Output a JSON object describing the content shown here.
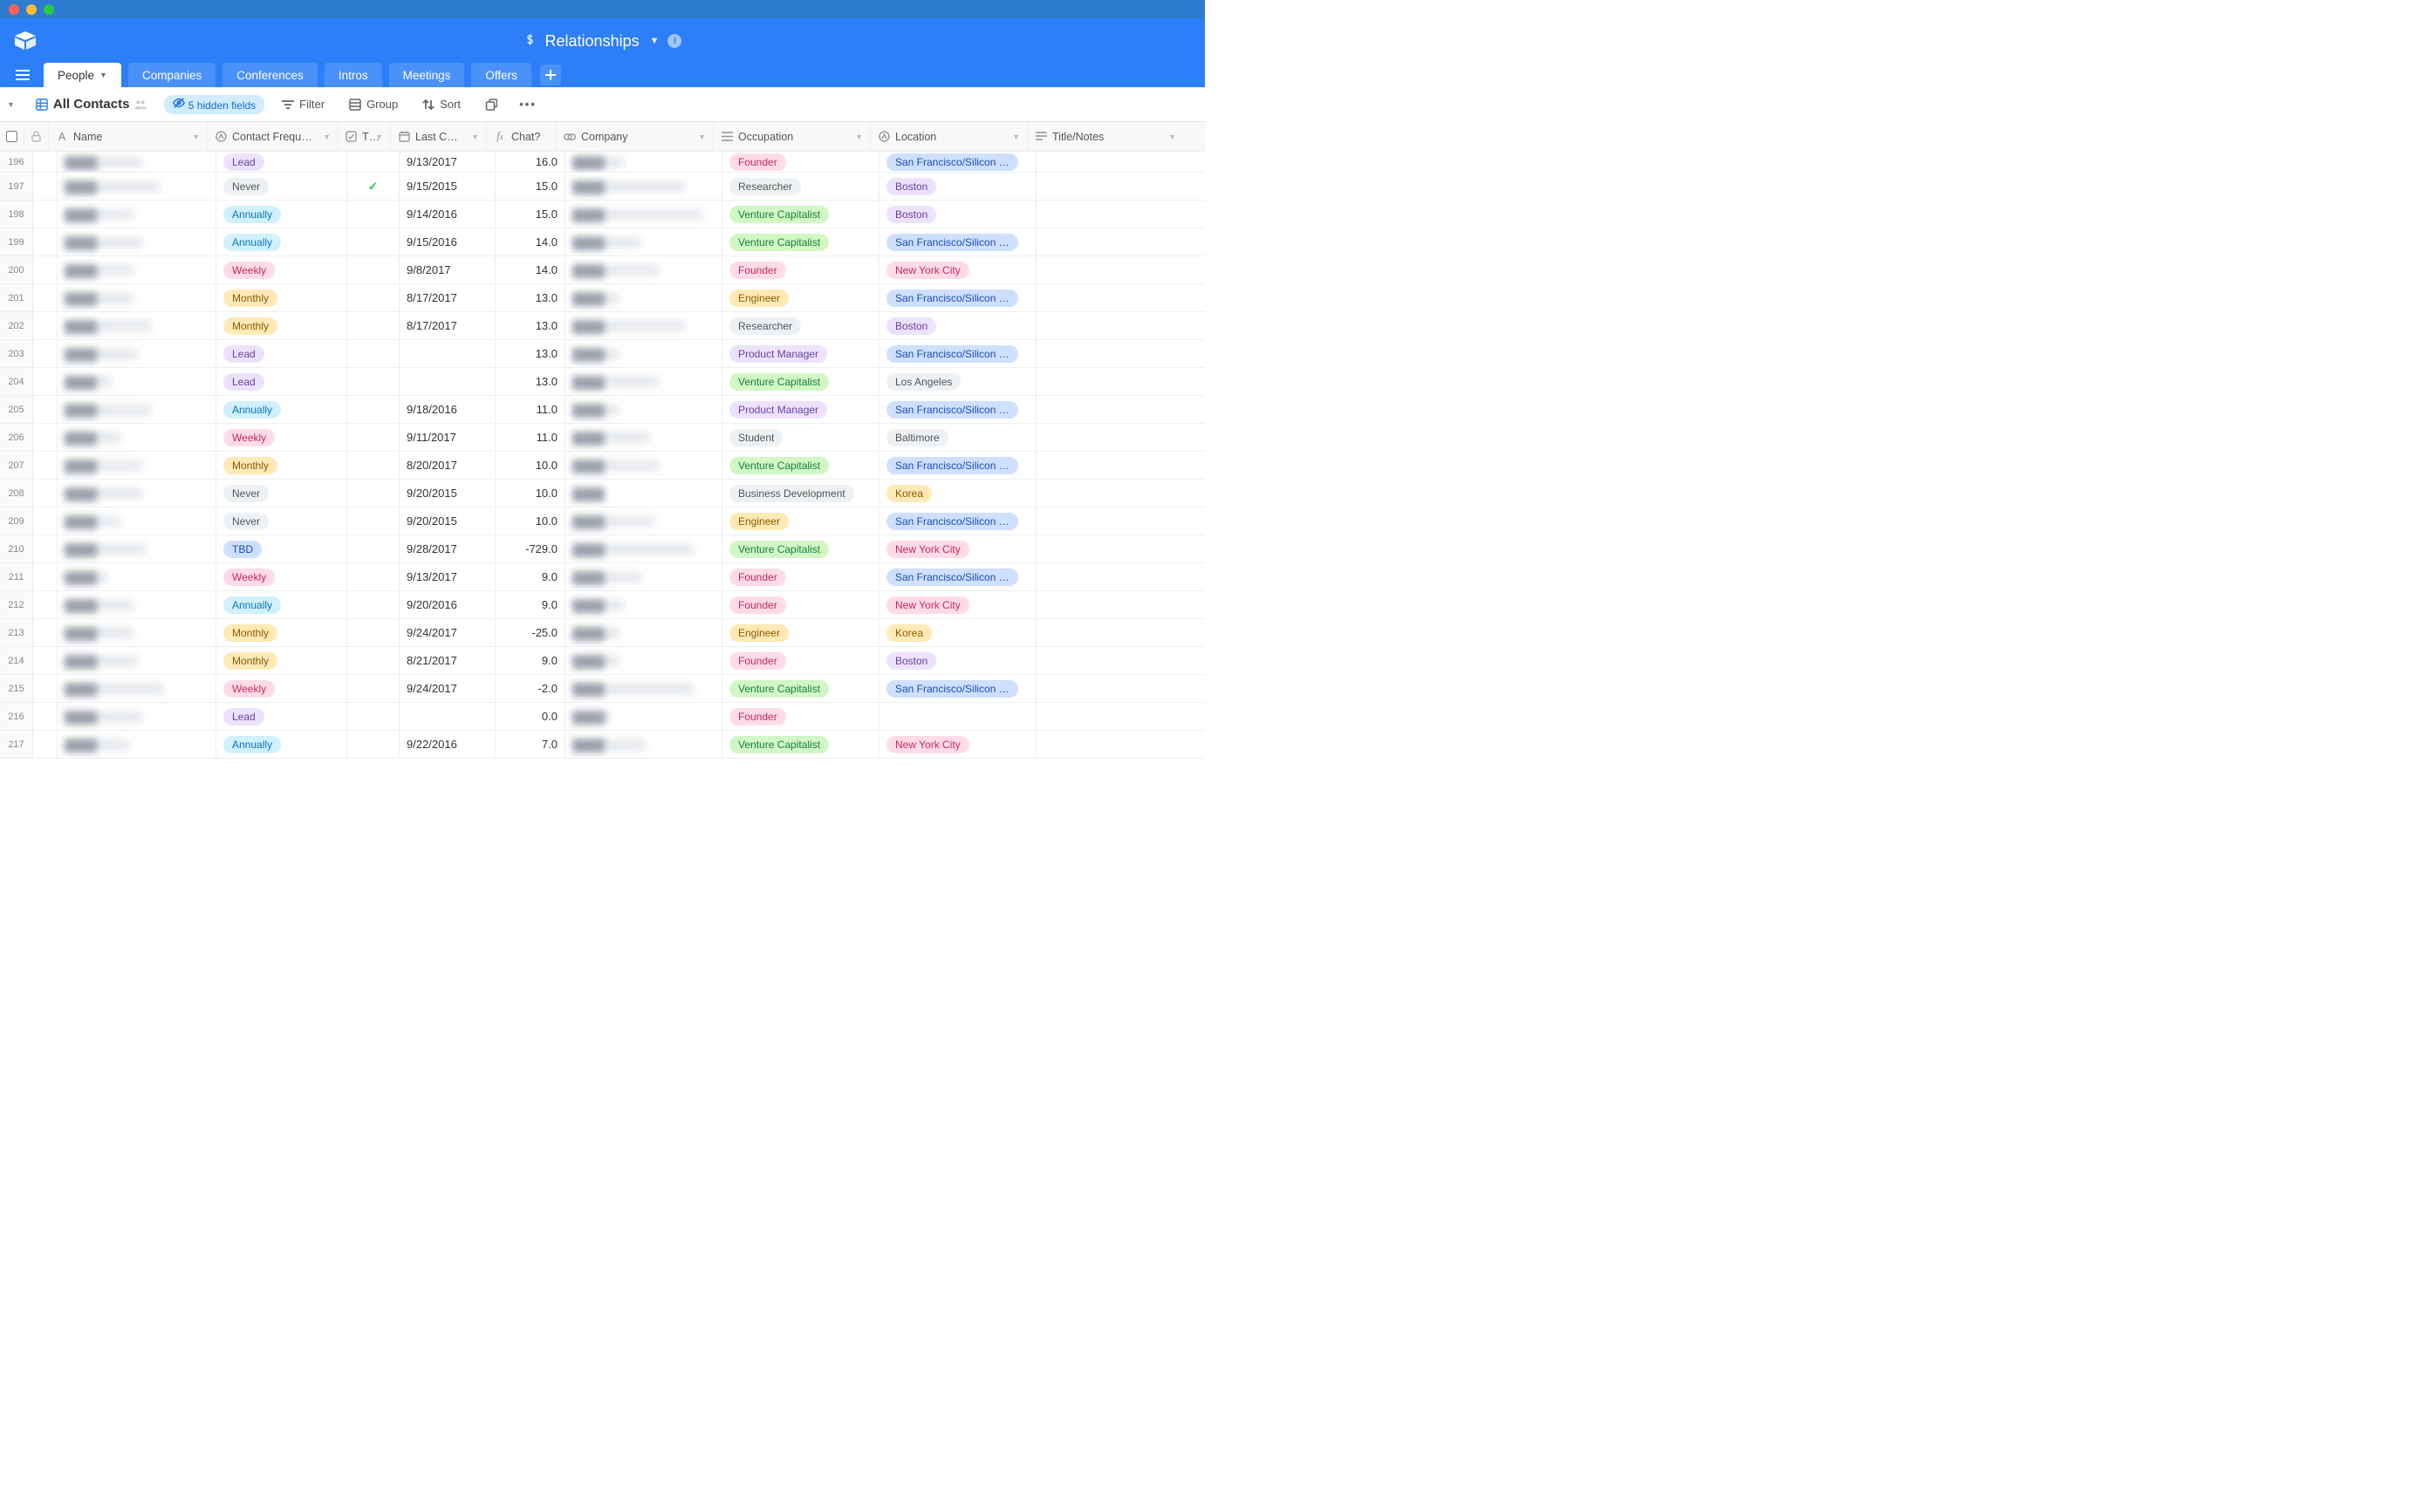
{
  "app": {
    "base_title": "Relationships"
  },
  "tabs": {
    "items": [
      {
        "label": "People",
        "active": true,
        "has_dropdown": true
      },
      {
        "label": "Companies"
      },
      {
        "label": "Conferences"
      },
      {
        "label": "Intros"
      },
      {
        "label": "Meetings"
      },
      {
        "label": "Offers"
      }
    ]
  },
  "toolbar": {
    "view_name": "All Contacts",
    "hidden_fields_label": "5 hidden fields",
    "filter_label": "Filter",
    "group_label": "Group",
    "sort_label": "Sort"
  },
  "columns": {
    "name": "Name",
    "contact_freq": "Contact Frequ…",
    "t": "T…",
    "last_c": "Last C…",
    "chat": "Chat?",
    "company": "Company",
    "occupation": "Occupation",
    "location": "Location",
    "title_notes": "Title/Notes"
  },
  "pill_colors": {
    "freq": {
      "Lead": "p-lead",
      "Never": "p-never",
      "Annually": "p-annually",
      "Weekly": "p-weekly",
      "Monthly": "p-monthly",
      "TBD": "p-tbd"
    },
    "occ": {
      "Founder": "o-founder",
      "Researcher": "o-researcher",
      "Venture Capitalist": "o-vc",
      "Engineer": "o-engineer",
      "Product Manager": "o-pm",
      "Student": "o-student",
      "Business Development": "o-bizdev"
    },
    "loc": {
      "San Francisco/Silicon …": "l-sf",
      "Boston": "l-boston",
      "New York City": "l-nyc",
      "Los Angeles": "l-la",
      "Baltimore": "l-balt",
      "Korea": "l-korea"
    }
  },
  "rows": [
    {
      "n": 196,
      "freq": "Lead",
      "t": false,
      "last": "9/13/2017",
      "chat": "16.0",
      "occ": "Founder",
      "loc": "San Francisco/Silicon …",
      "name_w": 90,
      "comp_w": 60
    },
    {
      "n": 197,
      "freq": "Never",
      "t": true,
      "last": "9/15/2015",
      "chat": "15.0",
      "occ": "Researcher",
      "loc": "Boston",
      "name_w": 110,
      "comp_w": 130
    },
    {
      "n": 198,
      "freq": "Annually",
      "t": false,
      "last": "9/14/2016",
      "chat": "15.0",
      "occ": "Venture Capitalist",
      "loc": "Boston",
      "name_w": 80,
      "comp_w": 150
    },
    {
      "n": 199,
      "freq": "Annually",
      "t": false,
      "last": "9/15/2016",
      "chat": "14.0",
      "occ": "Venture Capitalist",
      "loc": "San Francisco/Silicon …",
      "name_w": 90,
      "comp_w": 80
    },
    {
      "n": 200,
      "freq": "Weekly",
      "t": false,
      "last": "9/8/2017",
      "chat": "14.0",
      "occ": "Founder",
      "loc": "New York City",
      "name_w": 80,
      "comp_w": 100
    },
    {
      "n": 201,
      "freq": "Monthly",
      "t": false,
      "last": "8/17/2017",
      "chat": "13.0",
      "occ": "Engineer",
      "loc": "San Francisco/Silicon …",
      "name_w": 80,
      "comp_w": 55
    },
    {
      "n": 202,
      "freq": "Monthly",
      "t": false,
      "last": "8/17/2017",
      "chat": "13.0",
      "occ": "Researcher",
      "loc": "Boston",
      "name_w": 100,
      "comp_w": 130
    },
    {
      "n": 203,
      "freq": "Lead",
      "t": false,
      "last": "",
      "chat": "13.0",
      "occ": "Product Manager",
      "loc": "San Francisco/Silicon …",
      "name_w": 85,
      "comp_w": 55
    },
    {
      "n": 204,
      "freq": "Lead",
      "t": false,
      "last": "",
      "chat": "13.0",
      "occ": "Venture Capitalist",
      "loc": "Los Angeles",
      "name_w": 55,
      "comp_w": 100
    },
    {
      "n": 205,
      "freq": "Annually",
      "t": false,
      "last": "9/18/2016",
      "chat": "11.0",
      "occ": "Product Manager",
      "loc": "San Francisco/Silicon …",
      "name_w": 100,
      "comp_w": 55
    },
    {
      "n": 206,
      "freq": "Weekly",
      "t": false,
      "last": "9/11/2017",
      "chat": "11.0",
      "occ": "Student",
      "loc": "Baltimore",
      "name_w": 65,
      "comp_w": 90
    },
    {
      "n": 207,
      "freq": "Monthly",
      "t": false,
      "last": "8/20/2017",
      "chat": "10.0",
      "occ": "Venture Capitalist",
      "loc": "San Francisco/Silicon …",
      "name_w": 90,
      "comp_w": 100
    },
    {
      "n": 208,
      "freq": "Never",
      "t": false,
      "last": "9/20/2015",
      "chat": "10.0",
      "occ": "Business Development",
      "loc": "Korea",
      "name_w": 90,
      "comp_w": 30
    },
    {
      "n": 209,
      "freq": "Never",
      "t": false,
      "last": "9/20/2015",
      "chat": "10.0",
      "occ": "Engineer",
      "loc": "San Francisco/Silicon …",
      "name_w": 65,
      "comp_w": 95
    },
    {
      "n": 210,
      "freq": "TBD",
      "t": false,
      "last": "9/28/2017",
      "chat": "-729.0",
      "occ": "Venture Capitalist",
      "loc": "New York City",
      "name_w": 95,
      "comp_w": 140
    },
    {
      "n": 211,
      "freq": "Weekly",
      "t": false,
      "last": "9/13/2017",
      "chat": "9.0",
      "occ": "Founder",
      "loc": "San Francisco/Silicon …",
      "name_w": 50,
      "comp_w": 80
    },
    {
      "n": 212,
      "freq": "Annually",
      "t": false,
      "last": "9/20/2016",
      "chat": "9.0",
      "occ": "Founder",
      "loc": "New York City",
      "name_w": 80,
      "comp_w": 60
    },
    {
      "n": 213,
      "freq": "Monthly",
      "t": false,
      "last": "9/24/2017",
      "chat": "-25.0",
      "occ": "Engineer",
      "loc": "Korea",
      "name_w": 80,
      "comp_w": 55
    },
    {
      "n": 214,
      "freq": "Monthly",
      "t": false,
      "last": "8/21/2017",
      "chat": "9.0",
      "occ": "Founder",
      "loc": "Boston",
      "name_w": 85,
      "comp_w": 55
    },
    {
      "n": 215,
      "freq": "Weekly",
      "t": false,
      "last": "9/24/2017",
      "chat": "-2.0",
      "occ": "Venture Capitalist",
      "loc": "San Francisco/Silicon …",
      "name_w": 115,
      "comp_w": 140
    },
    {
      "n": 216,
      "freq": "Lead",
      "t": false,
      "last": "",
      "chat": "0.0",
      "occ": "Founder",
      "loc": "",
      "name_w": 90,
      "comp_w": 45
    },
    {
      "n": 217,
      "freq": "Annually",
      "t": false,
      "last": "9/22/2016",
      "chat": "7.0",
      "occ": "Venture Capitalist",
      "loc": "New York City",
      "name_w": 75,
      "comp_w": 85
    }
  ]
}
